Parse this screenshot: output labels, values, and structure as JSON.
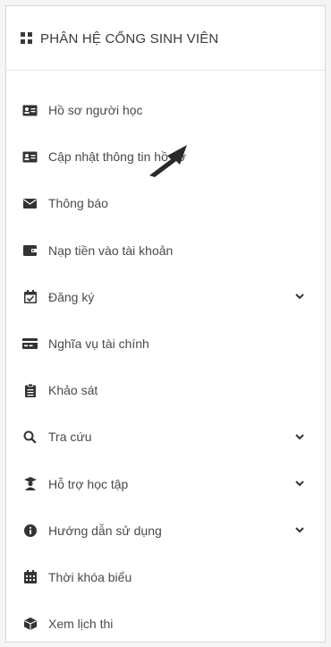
{
  "header": {
    "title": "PHÂN HỆ CỔNG SINH VIÊN",
    "icon": "grid-icon"
  },
  "menu": [
    {
      "label": "Hồ sơ người học",
      "icon": "id-card-icon",
      "has_dropdown": false
    },
    {
      "label": "Cập nhật thông tin hồ sơ",
      "icon": "id-card-edit-icon",
      "has_dropdown": false
    },
    {
      "label": "Thông báo",
      "icon": "envelope-icon",
      "has_dropdown": false
    },
    {
      "label": "Nạp tiền vào tài khoản",
      "icon": "wallet-icon",
      "has_dropdown": false
    },
    {
      "label": "Đăng ký",
      "icon": "calendar-check-icon",
      "has_dropdown": true
    },
    {
      "label": "Nghĩa vụ tài chính",
      "icon": "credit-card-icon",
      "has_dropdown": false
    },
    {
      "label": "Khảo sát",
      "icon": "clipboard-icon",
      "has_dropdown": false
    },
    {
      "label": "Tra cứu",
      "icon": "search-icon",
      "has_dropdown": true
    },
    {
      "label": "Hỗ trợ học tập",
      "icon": "graduate-icon",
      "has_dropdown": true
    },
    {
      "label": "Hướng dẫn sử dụng",
      "icon": "info-icon",
      "has_dropdown": true
    },
    {
      "label": "Thời khóa biểu",
      "icon": "calendar-icon",
      "has_dropdown": false
    },
    {
      "label": "Xem lịch thi",
      "icon": "cube-icon",
      "has_dropdown": false
    }
  ],
  "colors": {
    "icon": "#333333",
    "text": "#4a4a4a",
    "border": "#d8d8d8"
  }
}
